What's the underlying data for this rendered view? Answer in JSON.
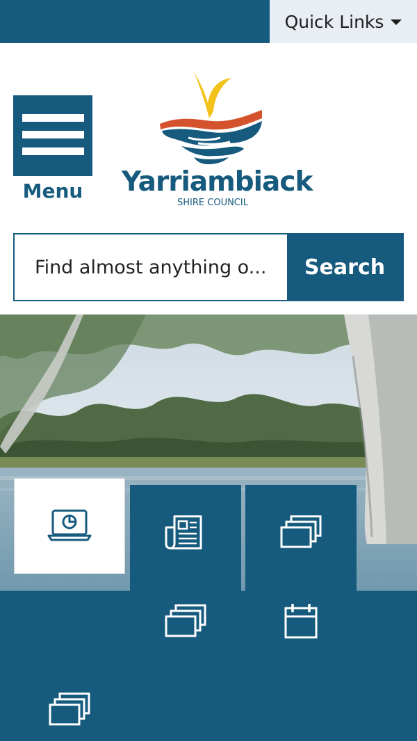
{
  "topbar": {
    "quick_links_label": "Quick Links"
  },
  "header": {
    "menu_label": "Menu",
    "logo": {
      "name": "Yarriambiack",
      "subtitle": "SHIRE COUNCIL"
    }
  },
  "search": {
    "placeholder": "Find almost anything o...",
    "value": "",
    "button_label": "Search"
  },
  "quick_tiles": [
    {
      "icon": "monitor-chart-icon",
      "active": true
    },
    {
      "icon": "newspaper-icon",
      "active": false
    },
    {
      "icon": "stacked-cards-icon",
      "active": false
    },
    {
      "icon": "stacked-cards-icon",
      "active": false
    },
    {
      "icon": "calendar-icon",
      "active": false
    },
    {
      "icon": "stacked-cards-icon",
      "active": false
    }
  ],
  "colors": {
    "brand_blue": "#165a7e",
    "quick_links_bg": "#e8eef3",
    "logo_orange": "#d4532c",
    "logo_yellow": "#f2c21a"
  }
}
